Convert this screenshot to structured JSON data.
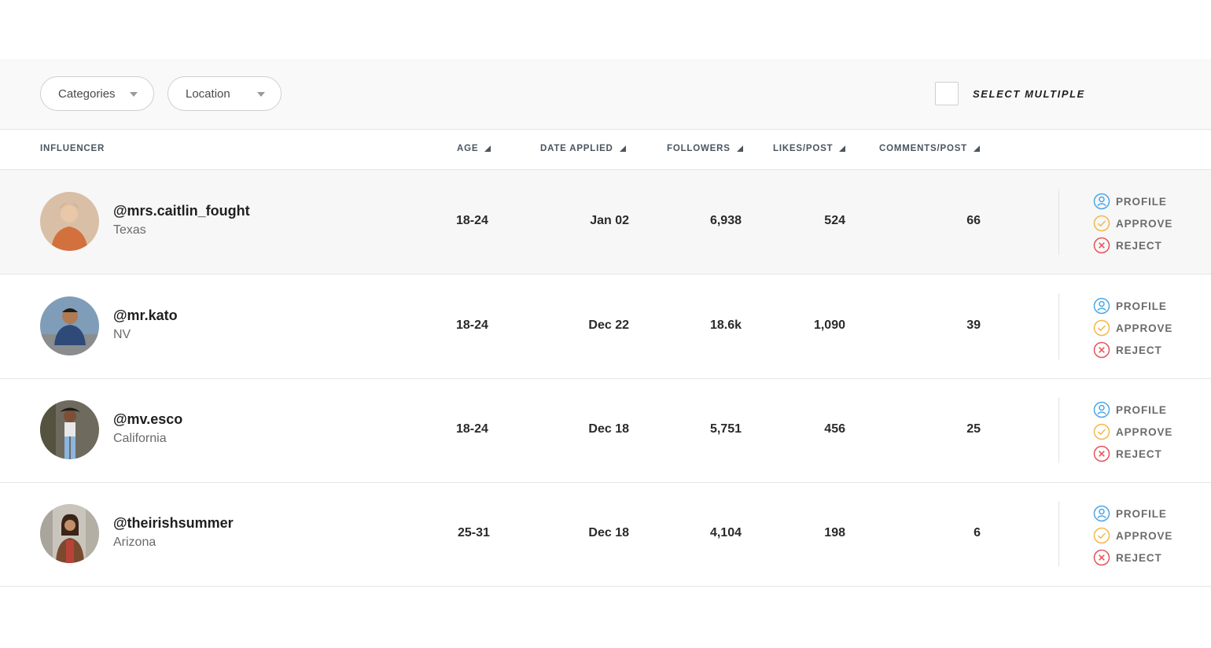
{
  "filters": {
    "categories_label": "Categories",
    "location_label": "Location",
    "select_multiple_label": "SELECT MULTIPLE"
  },
  "columns": {
    "influencer": "INFLUENCER",
    "age": "AGE",
    "date_applied": "DATE APPLIED",
    "followers": "FOLLOWERS",
    "likes_post": "LIKES/POST",
    "comments_post": "COMMENTS/POST"
  },
  "actions": {
    "profile": "PROFILE",
    "approve": "APPROVE",
    "reject": "REJECT"
  },
  "colors": {
    "profile": "#4aa6e8",
    "approve": "#f2b84b",
    "reject": "#e8525a"
  },
  "rows": [
    {
      "handle": "@mrs.caitlin_fought",
      "location": "Texas",
      "age": "18-24",
      "date": "Jan 02",
      "followers": "6,938",
      "likes": "524",
      "comments": "66"
    },
    {
      "handle": "@mr.kato",
      "location": "NV",
      "age": "18-24",
      "date": "Dec 22",
      "followers": "18.6k",
      "likes": "1,090",
      "comments": "39"
    },
    {
      "handle": "@mv.esco",
      "location": "California",
      "age": "18-24",
      "date": "Dec 18",
      "followers": "5,751",
      "likes": "456",
      "comments": "25"
    },
    {
      "handle": "@theirishsummer",
      "location": "Arizona",
      "age": "25-31",
      "date": "Dec 18",
      "followers": "4,104",
      "likes": "198",
      "comments": "6"
    }
  ]
}
